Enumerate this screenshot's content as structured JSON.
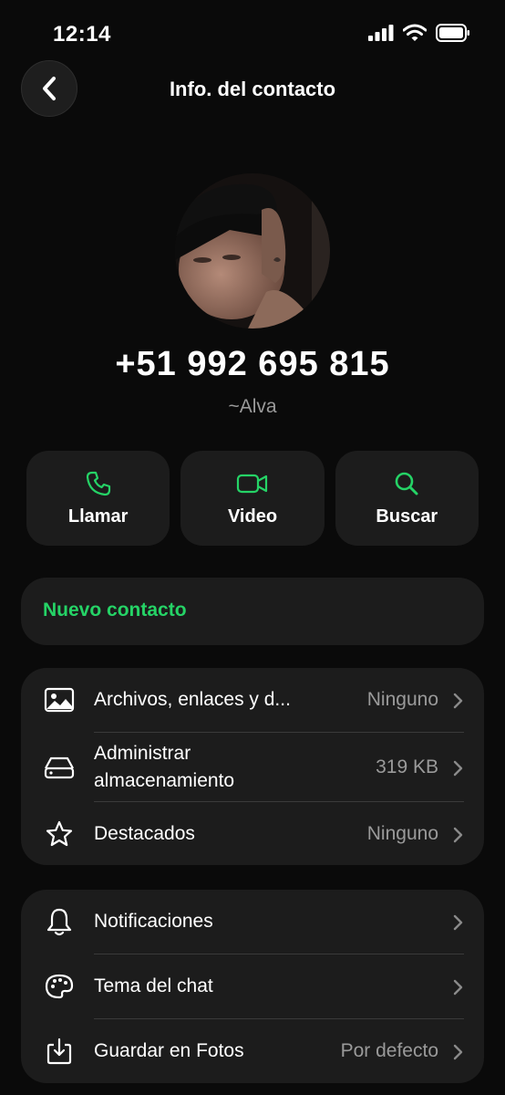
{
  "status_bar": {
    "time": "12:14"
  },
  "nav": {
    "title": "Info. del contacto"
  },
  "contact": {
    "phone": "+51 992 695 815",
    "alias": "~Alva"
  },
  "actions": [
    {
      "label": "Llamar",
      "icon": "phone-icon"
    },
    {
      "label": "Video",
      "icon": "video-icon"
    },
    {
      "label": "Buscar",
      "icon": "search-icon"
    }
  ],
  "new_contact": {
    "label": "Nuevo contacto"
  },
  "list1": [
    {
      "label": "Archivos, enlaces y d...",
      "value": "Ninguno",
      "icon": "image-icon"
    },
    {
      "label_line1": "Administrar",
      "label_line2": "almacenamiento",
      "value": "319 KB",
      "icon": "storage-icon"
    },
    {
      "label": "Destacados",
      "value": "Ninguno",
      "icon": "star-icon"
    }
  ],
  "list2": [
    {
      "label": "Notificaciones",
      "value": "",
      "icon": "bell-icon"
    },
    {
      "label": "Tema del chat",
      "value": "",
      "icon": "palette-icon"
    },
    {
      "label": "Guardar en Fotos",
      "value": "Por defecto",
      "icon": "save-to-photos-icon"
    }
  ],
  "colors": {
    "accent": "#25d366",
    "background": "#0a0a0a",
    "card": "#1c1c1c",
    "secondary_text": "#9a9a9a"
  }
}
